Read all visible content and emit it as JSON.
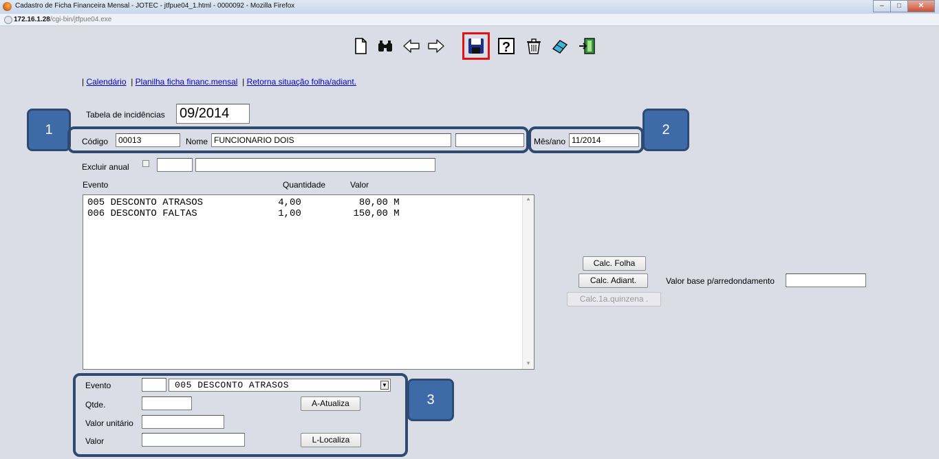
{
  "window": {
    "title": "Cadastro de Ficha Financeira Mensal - JOTEC - jtfpue04_1.html - 0000092 - Mozilla Firefox",
    "url_host": "172.16.1.28",
    "url_path": "/cgi-bin/jtfpue04.exe",
    "min_btn": "–",
    "max_btn": "□",
    "close_btn": "✕"
  },
  "toolbar": {
    "icons": [
      "new-document-icon",
      "binoculars-search-icon",
      "arrow-left-icon",
      "arrow-right-icon",
      "save-floppy-icon",
      "help-icon",
      "trash-icon",
      "eraser-icon",
      "exit-door-icon"
    ],
    "highlight_color": "#e31111"
  },
  "links": {
    "calendario": "Calendário",
    "planilha": "Planilha ficha financ.mensal",
    "retorna": "Retorna situação folha/adiant.",
    "sep": "|"
  },
  "form": {
    "tabela_label": "Tabela de incidências",
    "tabela_value": "09/2014",
    "codigo_label": "Código",
    "codigo_value": "00013",
    "nome_label": "Nome",
    "nome_value": "FUNCIONARIO DOIS",
    "nome_extra_value": "",
    "mesano_label": "Mês/ano",
    "mesano_value": "11/2014",
    "excluir_label": "Excluir anual",
    "excluir_field1": "",
    "excluir_field2": ""
  },
  "events_table": {
    "headers": {
      "evento": "Evento",
      "quantidade": "Quantidade",
      "valor": "Valor"
    },
    "rows": [
      "005 DESCONTO ATRASOS             4,00          80,00 M",
      "006 DESCONTO FALTAS              1,00         150,00 M"
    ]
  },
  "calc": {
    "folha": "Calc. Folha",
    "adiant": "Calc. Adiant.",
    "quinzena": "Calc.1a.quinzena .",
    "valor_base_label": "Valor base p/arredondamento",
    "valor_base_value": ""
  },
  "edit": {
    "evento_label": "Evento",
    "evento_code": "",
    "evento_selected": "005 DESCONTO ATRASOS",
    "qtde_label": "Qtde.",
    "qtde_value": "",
    "valor_unit_label": "Valor unitário",
    "valor_unit_value": "",
    "valor_label": "Valor",
    "valor_value": "",
    "atualiza": "A-Atualiza",
    "localiza": "L-Localiza"
  },
  "callouts": {
    "one": "1",
    "two": "2",
    "three": "3",
    "color": "#3f6aa8"
  }
}
